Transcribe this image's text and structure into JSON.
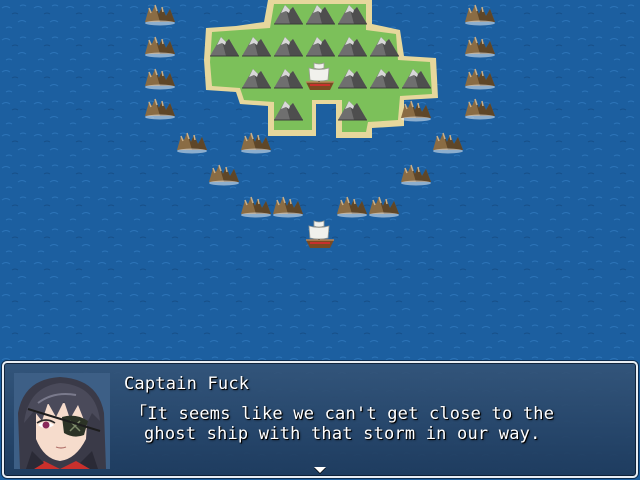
{
  "dialogue": {
    "speaker": "Captain Fuck",
    "lines": [
      "「It seems like we can't get close to the",
      "ghost ship with that storm in our way."
    ]
  },
  "map": {
    "sea_color": "#1c5fa0",
    "sand_color": "#e6d79c",
    "grass_color": "#7cc05a",
    "rock_color": "#8a8a8a"
  },
  "window": {
    "border_color": "#e9eef4",
    "fill_color": "#2b4f7a"
  }
}
